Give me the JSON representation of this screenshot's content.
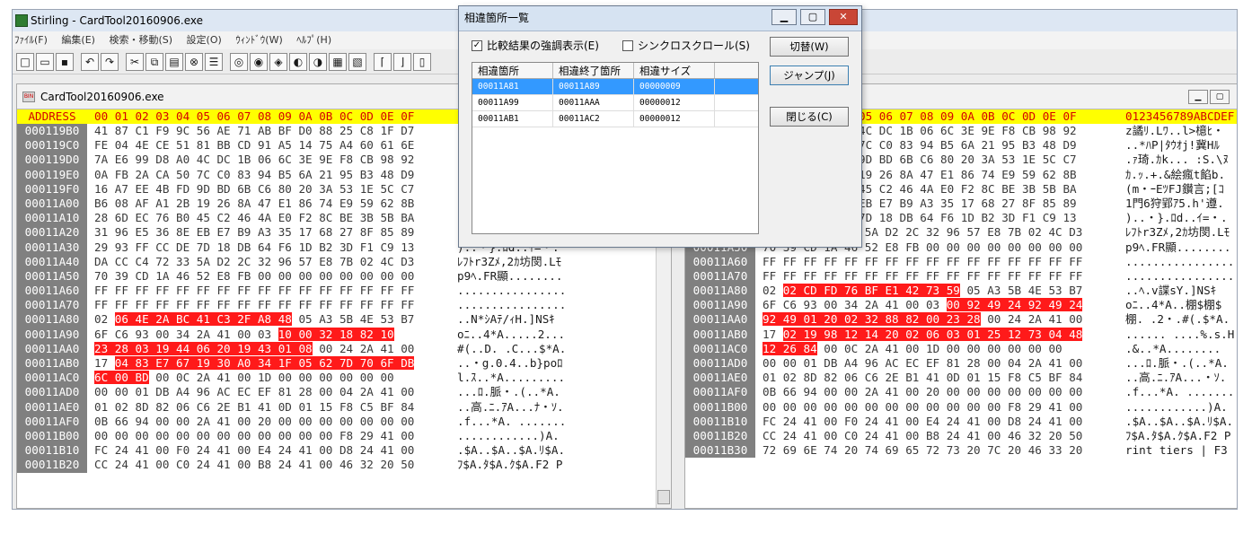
{
  "window": {
    "title": "Stirling - CardTool20160906.exe",
    "icon": "app-icon"
  },
  "menu": [
    "ﾌｧｲﾙ(F)",
    "編集(E)",
    "検索・移動(S)",
    "設定(O)",
    "ｳｨﾝﾄﾞｳ(W)",
    "ﾍﾙﾌﾟ(H)"
  ],
  "toolbar": {
    "new": "new-icon",
    "open": "open-icon",
    "save": "save-icon",
    "undo": "undo-icon",
    "redo": "redo-icon",
    "cut": "cut-icon",
    "copy": "copy-icon",
    "paste": "paste-icon",
    "delete": "delete-icon",
    "insert": "insert-icon",
    "find": "binoculars-icon",
    "findnext": "find-next-icon",
    "findprev": "find-prev-icon",
    "findbin": "find-binary-icon",
    "compare": "compare-icon",
    "diff": "diff-icon",
    "mark": "mark-icon",
    "block1": "block-start-icon",
    "block2": "block-end-icon",
    "block3": "block-icon"
  },
  "left": {
    "tab": "CardTool20160906.exe",
    "header": {
      "addr": "ADDRESS",
      "hex": "00 01 02 03 04 05 06 07 08 09 0A 0B 0C 0D 0E 0F"
    },
    "rows": [
      {
        "addr": "000119B0",
        "hex": [
          "41 87 C1 F9 9C 56 AE 71 AB BF D0 88 25 C8 1F D7",
          "",
          ""
        ],
        "asc": ""
      },
      {
        "addr": "000119C0",
        "hex": [
          "FE 04 4E CE 51 81 BB CD 91 A5 14 75 A4 60 61 6E",
          "",
          ""
        ],
        "asc": ""
      },
      {
        "addr": "000119D0",
        "hex": [
          "7A E6 99 D8 A0 4C DC 1B 06 6C 3E 9E F8 CB 98 92",
          "",
          ""
        ],
        "asc": ""
      },
      {
        "addr": "000119E0",
        "hex": [
          "0A FB 2A CA 50 7C C0 83 94 B5 6A 21 95 B3 48 D9",
          "",
          ""
        ],
        "asc": ""
      },
      {
        "addr": "000119F0",
        "hex": [
          "16 A7 EE 4B FD 9D BD 6B C6 80 20 3A 53 1E 5C C7",
          "",
          ""
        ],
        "asc": ""
      },
      {
        "addr": "00011A00",
        "hex": [
          "B6 08 AF A1 2B 19 26 8A 47 E1 86 74 E9 59 62 8B",
          "",
          ""
        ],
        "asc": ""
      },
      {
        "addr": "00011A10",
        "hex": [
          "28 6D EC 76 B0 45 C2 46 4A E0 F2 8C BE 3B 5B BA",
          "",
          ""
        ],
        "asc": ""
      },
      {
        "addr": "00011A20",
        "hex": [
          "31 96 E5 36 8E EB E7 B9 A3 35 17 68 27 8F 85 89",
          "",
          ""
        ],
        "asc": ""
      },
      {
        "addr": "00011A30",
        "hex": [
          "29 93 FF CC DE 7D 18 DB 64 F6 1D B2 3D F1 C9 13",
          "",
          ""
        ],
        "asc": ")..・}.ﾛd..ｲ=・."
      },
      {
        "addr": "00011A40",
        "hex": [
          "DA CC C4 72 33 5A D2 2C 32 96 57 E8 7B 02 4C D3",
          "",
          ""
        ],
        "asc": "ﾚﾌﾄr3Zﾒ,2ｶ坊閔.Lﾓ"
      },
      {
        "addr": "00011A50",
        "hex": [
          "70 39 CD 1A 46 52 E8 FB 00 00 00 00 00 00 00 00",
          "",
          ""
        ],
        "asc": "p9ﾍ.FR顯........"
      },
      {
        "addr": "00011A60",
        "hex": [
          "FF FF FF FF FF FF FF FF FF FF FF FF FF FF FF FF",
          "",
          ""
        ],
        "asc": "................"
      },
      {
        "addr": "00011A70",
        "hex": [
          "FF FF FF FF FF FF FF FF FF FF FF FF FF FF FF FF",
          "",
          ""
        ],
        "asc": "................"
      },
      {
        "addr": "00011A80",
        "hex": [
          "02 ",
          "06 4E 2A BC 41 C3 2F A8 48",
          " 05 A3 5B 4E 53 B7"
        ],
        "asc": "..N*ｼAﾃ/ｨH.]NSｷ"
      },
      {
        "addr": "00011A90",
        "hex": [
          "6F C6 93 00 34 2A 41 00 03 ",
          "10 00 32 18 82 10",
          ""
        ],
        "asc": "oﾆ..4*A.....2..."
      },
      {
        "addr": "00011AA0",
        "hex": [
          "",
          "23 28 03 19 44 06 20 19 43 01 08",
          " 00 24 2A 41 00"
        ],
        "asc": "#(..D. .C...$*A."
      },
      {
        "addr": "00011AB0",
        "hex": [
          "17 ",
          "04 83 E7 67 19 30 A0 34 1F 05 62 7D 70 6F DB",
          ""
        ],
        "asc": "..・g.0.4..b}poﾛ"
      },
      {
        "addr": "00011AC0",
        "hex": [
          "",
          "6C 00 BD",
          " 00 0C 2A 41 00 1D 00 00 00 00 00 00"
        ],
        "asc": "l.ｽ..*A........."
      },
      {
        "addr": "00011AD0",
        "hex": [
          "00 00 01 DB A4 96 AC EC EF 81 28 00 04 2A 41 00",
          "",
          ""
        ],
        "asc": "...ﾛ.脈・.(..*A."
      },
      {
        "addr": "00011AE0",
        "hex": [
          "01 02 8D 82 06 C6 2E B1 41 0D 01 15 F8 C5 BF 84",
          "",
          ""
        ],
        "asc": "..高.ﾆ.ｱA...ﾅ・ｿ."
      },
      {
        "addr": "00011AF0",
        "hex": [
          "0B 66 94 00 00 2A 41 00 20 00 00 00 00 00 00 00",
          "",
          ""
        ],
        "asc": ".f...*A. ......."
      },
      {
        "addr": "00011B00",
        "hex": [
          "00 00 00 00 00 00 00 00 00 00 00 00 F8 29 41 00",
          "",
          ""
        ],
        "asc": "............)A."
      },
      {
        "addr": "00011B10",
        "hex": [
          "FC 24 41 00 F0 24 41 00 E4 24 41 00 D8 24 41 00",
          "",
          ""
        ],
        "asc": ".$A..$A..$A.ﾘ$A."
      },
      {
        "addr": "00011B20",
        "hex": [
          "CC 24 41 00 C0 24 41 00 B8 24 41 00 46 32 20 50",
          "",
          ""
        ],
        "asc": "ﾌ$A.ﾀ$A.ｸ$A.F2 P"
      }
    ]
  },
  "right": {
    "header": {
      "hex": "05 06 07 08 09 0A 0B 0C 0D 0E 0F",
      "asc": "0123456789ABCDEF"
    },
    "rows": [
      {
        "addr": "",
        "hex": [
          "4C DC 1B 06 6C 3E 9E F8 CB 98 92",
          "",
          ""
        ],
        "asc": "z譎ﾘ.Lﾜ..l>檍ﾋ・"
      },
      {
        "addr": "",
        "hex": [
          "7C C0 83 94 B5 6A 21 95 B3 48 D9",
          "",
          ""
        ],
        "asc": "..*ﾊP|ﾀｳｵj!冀Hﾙ"
      },
      {
        "addr": "",
        "hex": [
          "9D BD 6B C6 80 20 3A 53 1E 5C C7",
          "",
          ""
        ],
        "asc": ".ｧ琦.ｶk... :S.\\ﾇ"
      },
      {
        "addr": "",
        "hex": [
          "19 26 8A 47 E1 86 74 E9 59 62 8B",
          "",
          ""
        ],
        "asc": "ｶ.ｯ.+.&絵瘋t餡b."
      },
      {
        "addr": "",
        "hex": [
          "45 C2 46 4A E0 F2 8C BE 3B 5B BA",
          "",
          ""
        ],
        "asc": "(m・ｰEﾂFJ鑚言;[ｺ"
      },
      {
        "addr": "",
        "hex": [
          "EB E7 B9 A3 35 17 68 27 8F 85 89",
          "",
          ""
        ],
        "asc": "1門6狩郢ｱ5.h'遵."
      },
      {
        "addr": "",
        "hex": [
          "7D 18 DB 64 F6 1D B2 3D F1 C9 13",
          "",
          ""
        ],
        "asc": ")..・}.ﾛd..ｲ=・."
      },
      {
        "addr": "00011A40",
        "hex": [
          "DA CC C4 72 33 5A D2 2C 32 96 57 E8 7B 02 4C D3",
          "",
          ""
        ],
        "asc": "ﾚﾌﾄr3Zﾒ,2ｶ坊閔.Lﾓ"
      },
      {
        "addr": "00011A50",
        "hex": [
          "70 39 CD 1A 46 52 E8 FB 00 00 00 00 00 00 00 00",
          "",
          ""
        ],
        "asc": "p9ﾍ.FR顯........"
      },
      {
        "addr": "00011A60",
        "hex": [
          "FF FF FF FF FF FF FF FF FF FF FF FF FF FF FF FF",
          "",
          ""
        ],
        "asc": "................"
      },
      {
        "addr": "00011A70",
        "hex": [
          "FF FF FF FF FF FF FF FF FF FF FF FF FF FF FF FF",
          "",
          ""
        ],
        "asc": "................"
      },
      {
        "addr": "00011A80",
        "hex": [
          "02 ",
          "02 CD FD 76 BF E1 42 73 59",
          " 05 A3 5B 4E 53 B7"
        ],
        "asc": "..ﾍ.v諜sY.]NSｷ"
      },
      {
        "addr": "00011A90",
        "hex": [
          "6F C6 93 00 34 2A 41 00 03 ",
          "00 92 49 24 92 49 24",
          ""
        ],
        "asc": "oﾆ..4*A..棚$棚$"
      },
      {
        "addr": "00011AA0",
        "hex": [
          "",
          "92 49 01 20 02 32 88 82 00 23 28",
          " 00 24 2A 41 00"
        ],
        "asc": "棚. .2・.#(.$*A."
      },
      {
        "addr": "00011AB0",
        "hex": [
          "17 ",
          "02 19 98 12 14 20 02 06 03 01 25 12 73 04 48",
          ""
        ],
        "asc": "...... ....%.s.H"
      },
      {
        "addr": "00011AC0",
        "hex": [
          "",
          "12 26 84",
          " 00 0C 2A 41 00 1D 00 00 00 00 00 00"
        ],
        "asc": ".&..*A........"
      },
      {
        "addr": "00011AD0",
        "hex": [
          "00 00 01 DB A4 96 AC EC EF 81 28 00 04 2A 41 00",
          "",
          ""
        ],
        "asc": "...ﾛ.脈・.(..*A."
      },
      {
        "addr": "00011AE0",
        "hex": [
          "01 02 8D 82 06 C6 2E B1 41 0D 01 15 F8 C5 BF 84",
          "",
          ""
        ],
        "asc": "..高.ﾆ.ｱA...・ｿ."
      },
      {
        "addr": "00011AF0",
        "hex": [
          "0B 66 94 00 00 2A 41 00 20 00 00 00 00 00 00 00",
          "",
          ""
        ],
        "asc": ".f...*A. ......."
      },
      {
        "addr": "00011B00",
        "hex": [
          "00 00 00 00 00 00 00 00 00 00 00 00 F8 29 41 00",
          "",
          ""
        ],
        "asc": "............)A."
      },
      {
        "addr": "00011B10",
        "hex": [
          "FC 24 41 00 F0 24 41 00 E4 24 41 00 D8 24 41 00",
          "",
          ""
        ],
        "asc": ".$A..$A..$A.ﾘ$A."
      },
      {
        "addr": "00011B20",
        "hex": [
          "CC 24 41 00 C0 24 41 00 B8 24 41 00 46 32 20 50",
          "",
          ""
        ],
        "asc": "ﾌ$A.ﾀ$A.ｸ$A.F2 P"
      },
      {
        "addr": "00011B30",
        "hex": [
          "72 69 6E 74 20 74 69 65 72 73 20 7C 20 46 33 20",
          "",
          ""
        ],
        "asc": "rint tiers | F3 "
      }
    ]
  },
  "dialog": {
    "title": "相違箇所一覧",
    "minimize": "minimize-icon",
    "maximize": "maximize-icon",
    "close": "close-icon",
    "highlight_label": "比較結果の強調表示(E)",
    "highlight_checked": true,
    "sync_label": "シンクロスクロール(S)",
    "sync_checked": false,
    "columns": [
      "相違箇所",
      "相違終了箇所",
      "相違サイズ"
    ],
    "items": [
      {
        "start": "00011A81",
        "end": "00011A89",
        "size": "00000009",
        "selected": true
      },
      {
        "start": "00011A99",
        "end": "00011AAA",
        "size": "00000012",
        "selected": false
      },
      {
        "start": "00011AB1",
        "end": "00011AC2",
        "size": "00000012",
        "selected": false
      }
    ],
    "switch_label": "切替(W)",
    "jump_label": "ジャンプ(J)",
    "close_label": "閉じる(C)"
  }
}
